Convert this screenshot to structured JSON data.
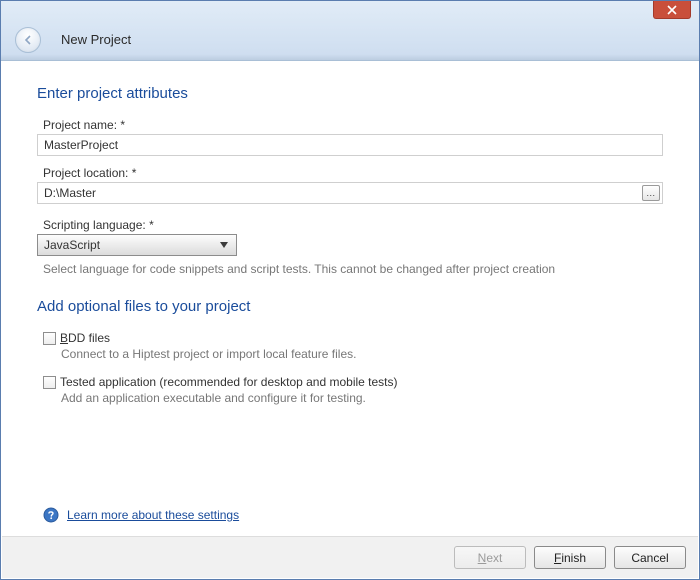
{
  "window": {
    "title": "New Project"
  },
  "section1": {
    "header": "Enter project attributes",
    "name_label": "Project name: *",
    "name_value": "MasterProject",
    "location_label": "Project location: *",
    "location_value": "D:\\Master",
    "browse_ellipsis": "...",
    "lang_label": "Scripting language: *",
    "lang_value": "JavaScript",
    "lang_hint": "Select language for code snippets and script tests. This cannot be changed after project creation"
  },
  "section2": {
    "header": "Add optional files to your project",
    "bdd_prefix": "B",
    "bdd_rest": "DD files",
    "bdd_desc": "Connect to a Hiptest project or import local feature files.",
    "tested_label": "Tested application (recommended for desktop and mobile tests)",
    "tested_desc": "Add an application executable and configure it for testing."
  },
  "help": {
    "link": "Learn more about these settings"
  },
  "footer": {
    "next_prefix": "N",
    "next_rest": "ext",
    "finish_prefix": "F",
    "finish_rest": "inish",
    "cancel": "Cancel"
  }
}
